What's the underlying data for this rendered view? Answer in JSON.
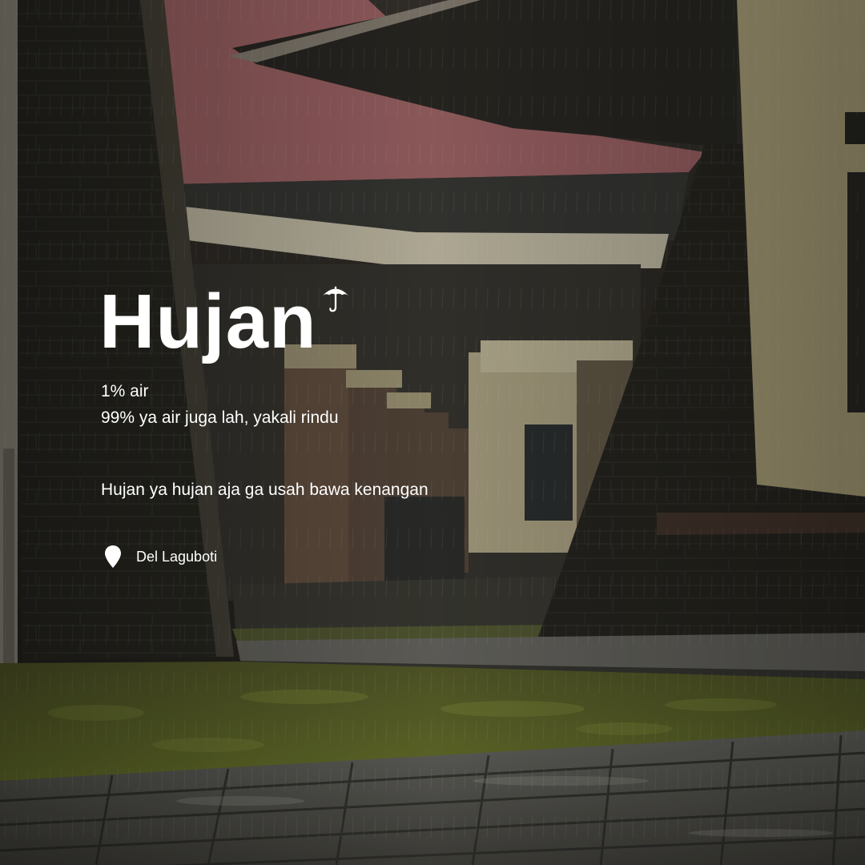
{
  "post": {
    "title": "Hujan",
    "line_1": "1% air",
    "line_2": "99% ya air juga lah, yakali rindu",
    "tagline": "Hujan ya hujan aja ga usah bawa kenangan",
    "location": "Del Laguboti"
  },
  "icons": {
    "title_icon": "umbrella-icon",
    "location_icon": "map-pin-icon"
  },
  "colors": {
    "text": "#ffffff",
    "roof": "#a7696b",
    "grass": "#6f7a2e",
    "wall_dark": "#2b2a24",
    "wall_light": "#b9ae84"
  }
}
